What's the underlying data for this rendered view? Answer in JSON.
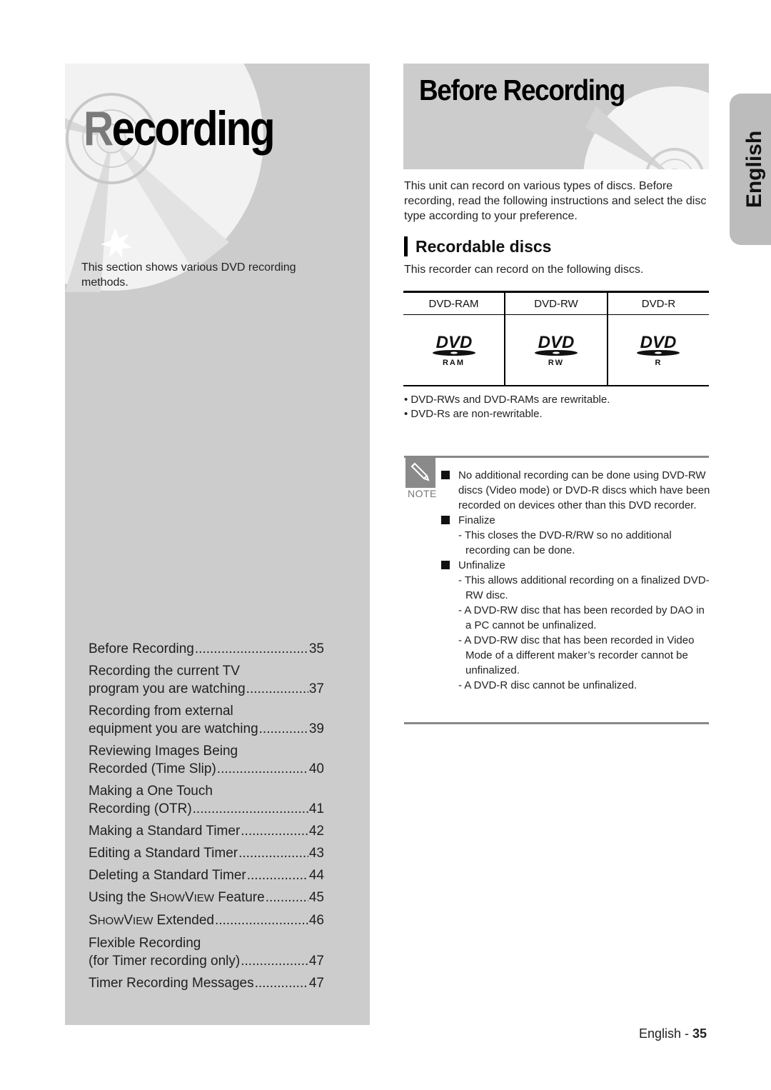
{
  "left": {
    "title_first": "R",
    "title_rest": "ecording",
    "intro": "This section shows various DVD recording methods.",
    "toc": [
      {
        "lines": [
          "Before Recording"
        ],
        "page": "35"
      },
      {
        "lines": [
          "Recording the current TV",
          "program you are watching"
        ],
        "page": "37"
      },
      {
        "lines": [
          "Recording from external",
          "equipment you are watching"
        ],
        "page": "39"
      },
      {
        "lines": [
          "Reviewing Images Being",
          "Recorded (Time Slip)"
        ],
        "page": "40"
      },
      {
        "lines": [
          "Making a One Touch",
          "Recording (OTR)"
        ],
        "page": "41"
      },
      {
        "lines": [
          "Making a Standard Timer"
        ],
        "page": "42"
      },
      {
        "lines": [
          "Editing a Standard Timer"
        ],
        "page": "43"
      },
      {
        "lines": [
          "Deleting a Standard Timer"
        ],
        "page": "44"
      },
      {
        "lines": [
          "Using the ShowView Feature"
        ],
        "page": "45"
      },
      {
        "lines": [
          "ShowView Extended"
        ],
        "page": "46"
      },
      {
        "lines": [
          "Flexible Recording",
          "(for Timer recording only)"
        ],
        "page": "47"
      },
      {
        "lines": [
          "Timer Recording Messages"
        ],
        "page": "47"
      }
    ]
  },
  "right": {
    "title": "Before Recording",
    "intro": "This unit can record on various types of discs. Before recording, read the following instructions and select the disc type according to your preference.",
    "section_heading": "Recordable discs",
    "section_intro": "This recorder can record on the following discs.",
    "disc_table": {
      "headers": [
        "DVD-RAM",
        "DVD-RW",
        "DVD-R"
      ],
      "logos": [
        {
          "icon": "dvd-logo-icon",
          "sub": "RAM"
        },
        {
          "icon": "dvd-logo-icon",
          "sub": "RW"
        },
        {
          "icon": "dvd-logo-icon",
          "sub": "R"
        }
      ]
    },
    "bullets": [
      "DVD-RWs and DVD-RAMs are rewritable.",
      "DVD-Rs are non-rewritable."
    ],
    "note": {
      "label": "NOTE",
      "icon": "pencil-icon",
      "items": [
        {
          "text": "No additional recording can be done using DVD-RW discs (Video mode) or DVD-R discs which have been recorded on devices other than this DVD recorder.",
          "subs": []
        },
        {
          "text": "Finalize",
          "subs": [
            "- This closes the DVD-R/RW so no additional recording can be done."
          ]
        },
        {
          "text": "Unfinalize",
          "subs": [
            "- This allows additional recording on a finalized DVD-RW disc.",
            "- A DVD-RW disc that has been recorded by DAO in a PC cannot be unfinalized.",
            "- A DVD-RW disc that has been recorded in Video Mode of a different maker’s recorder cannot be unfinalized.",
            "- A DVD-R disc cannot be unfinalized."
          ]
        }
      ]
    }
  },
  "side_tab": "English",
  "footer": {
    "lang": "English",
    "sep": " - ",
    "page": "35"
  }
}
